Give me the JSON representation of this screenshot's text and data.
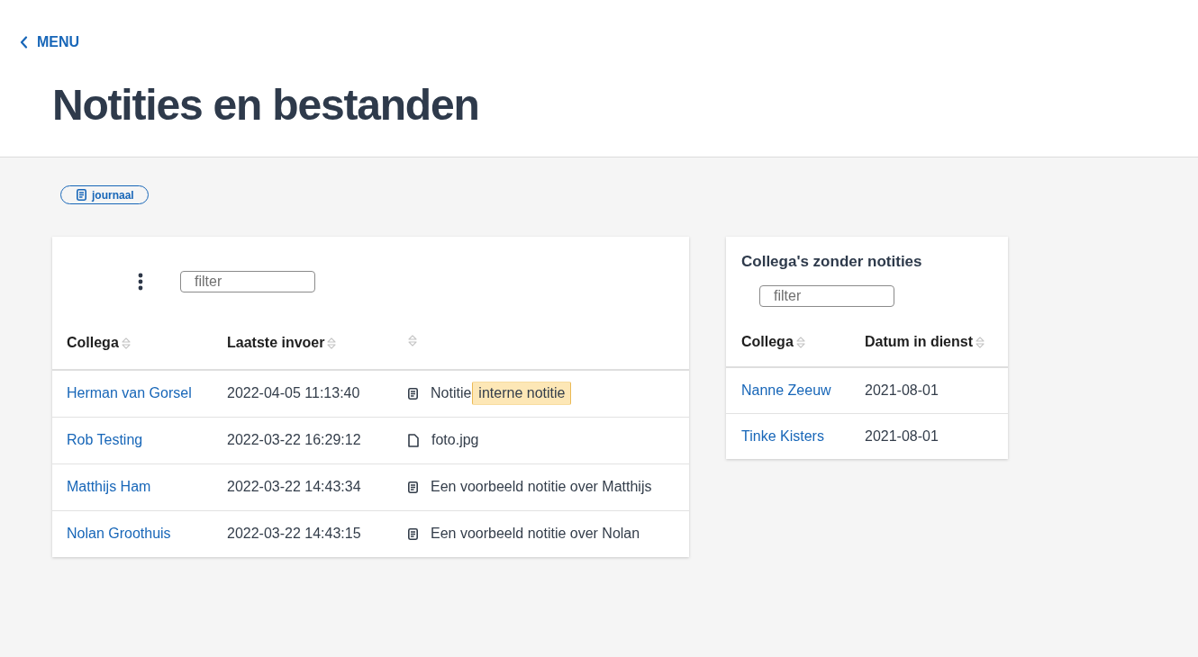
{
  "back_link": {
    "label": "MENU"
  },
  "page_title": "Notities en bestanden",
  "tags": [
    {
      "label": "journaal"
    }
  ],
  "notes_table": {
    "filter": {
      "placeholder": "filter"
    },
    "columns": [
      {
        "kind": "labeled",
        "label": "Collega"
      },
      {
        "kind": "labeled",
        "label": "Laatste invoer"
      },
      {
        "kind": "unlabeled"
      }
    ],
    "rows": [
      {
        "colleague": "Herman van Gorsel",
        "last_entry": "2022-04-05 11:13:40",
        "entry": {
          "kind": "note",
          "text": "Notitie",
          "tag": "interne notitie"
        }
      },
      {
        "colleague": "Rob Testing",
        "last_entry": "2022-03-22 16:29:12",
        "entry": {
          "kind": "file",
          "text": "foto.jpg"
        }
      },
      {
        "colleague": "Matthijs Ham",
        "last_entry": "2022-03-22 14:43:34",
        "entry": {
          "kind": "note",
          "text": "Een voorbeeld notitie over Matthijs"
        }
      },
      {
        "colleague": "Nolan Groothuis",
        "last_entry": "2022-03-22 14:43:15",
        "entry": {
          "kind": "note",
          "text": "Een voorbeeld notitie over Nolan"
        }
      }
    ]
  },
  "colleagues_without_notes": {
    "title": "Collega's zonder notities",
    "filter": {
      "placeholder": "filter"
    },
    "columns": [
      {
        "label": "Collega"
      },
      {
        "label": "Datum in dienst"
      }
    ],
    "rows": [
      {
        "colleague": "Nanne Zeeuw",
        "start_date": "2021-08-01"
      },
      {
        "colleague": "Tinke Kisters",
        "start_date": "2021-08-01"
      }
    ]
  }
}
